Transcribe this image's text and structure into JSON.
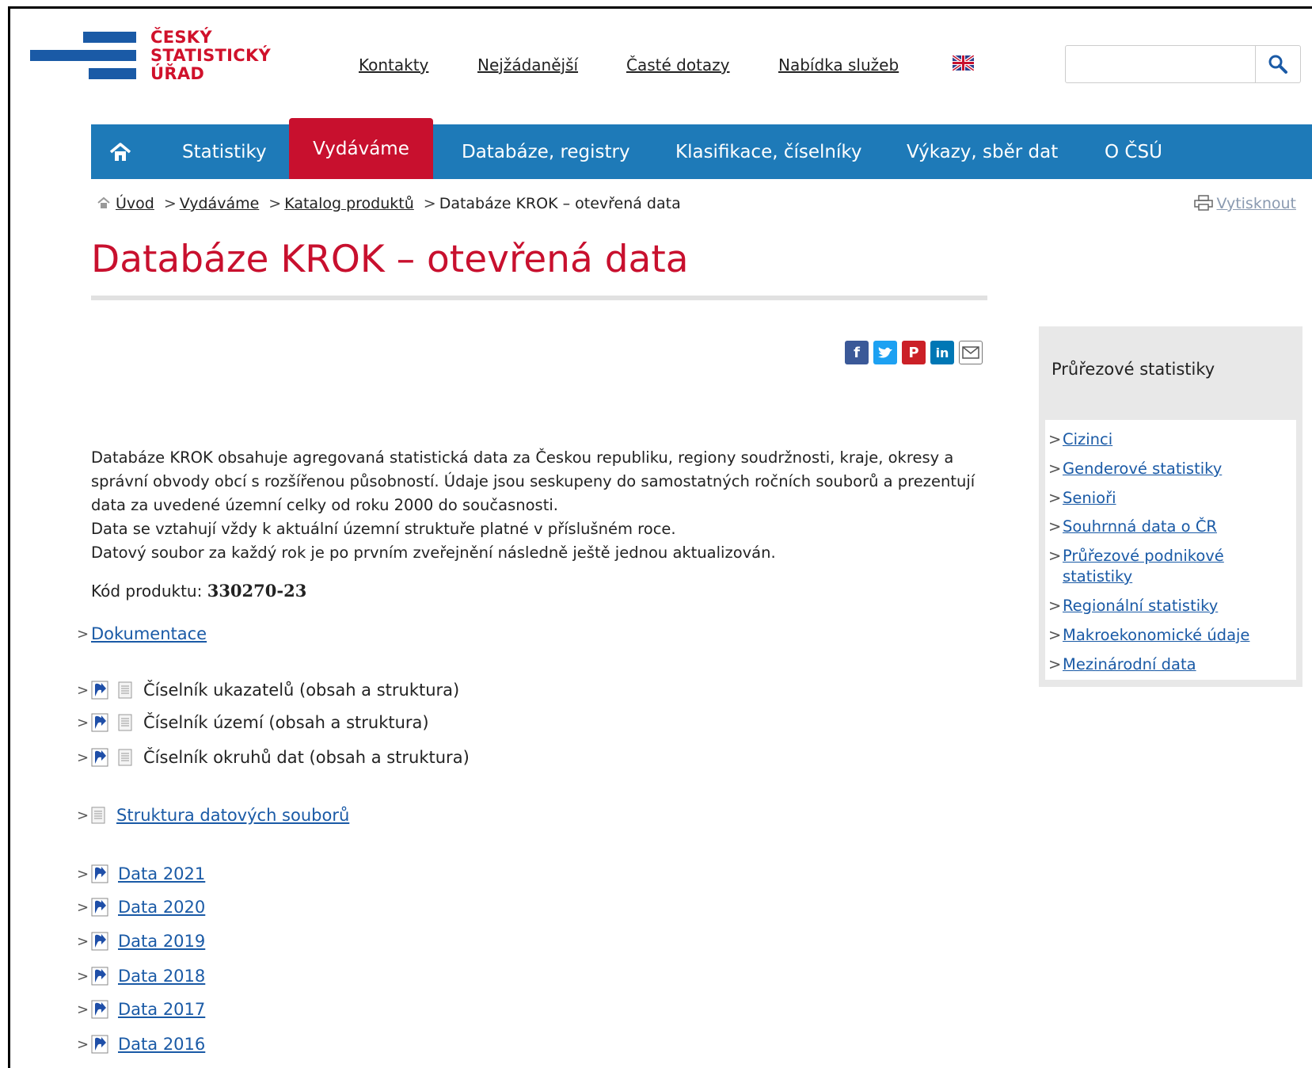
{
  "logo": {
    "line1": "ČESKÝ",
    "line2": "STATISTICKÝ",
    "line3": "ÚŘAD"
  },
  "toplinks": [
    "Kontakty",
    "Nejžádanější",
    "Časté dotazy",
    "Nabídka služeb"
  ],
  "nav": {
    "items": [
      "Statistiky",
      "Vydáváme",
      "Databáze, registry",
      "Klasifikace, číselníky",
      "Výkazy, sběr dat",
      "O ČSÚ"
    ],
    "active": "Vydáváme"
  },
  "breadcrumb": {
    "items": [
      "Úvod",
      "Vydáváme",
      "Katalog produktů"
    ],
    "current": "Databáze KROK – otevřená data",
    "print": "Vytisknout"
  },
  "page_title": "Databáze KROK – otevřená data",
  "description": [
    "Databáze KROK obsahuje agregovaná statistická data za Českou republiku, regiony soudržnosti, kraje, okresy a správní obvody obcí s rozšířenou působností. Údaje jsou seskupeny do samostatných ročních souborů a prezentují data za uvedené územní celky od roku 2000 do současnosti.",
    "Data se vztahují vždy k aktuální územní struktuře platné v příslušném roce.",
    "Datový soubor za každý rok je po prvním zveřejnění následně ještě jednou aktualizován."
  ],
  "product_code": {
    "label": "Kód produktu:",
    "value": "330270-23"
  },
  "documentation": "Dokumentace",
  "codelists": [
    "Číselník ukazatelů (obsah a struktura)",
    "Číselník území (obsah a struktura)",
    "Číselník okruhů dat (obsah a struktura)"
  ],
  "structure_link": "Struktura datových souborů",
  "data_links": [
    "Data 2021",
    "Data 2020",
    "Data 2019",
    "Data 2018",
    "Data 2017",
    "Data 2016"
  ],
  "sidebar": {
    "title": "Průřezové statistiky",
    "items": [
      "Cizinci",
      "Genderové statistiky",
      "Senioři",
      "Souhrnná data o ČR",
      "Průřezové podnikové statistiky",
      "Regionální statistiky",
      "Makroekonomické údaje",
      "Mezinárodní data"
    ]
  },
  "colors": {
    "brand_red": "#c8102e",
    "brand_blue": "#1e7ab8",
    "link": "#1a5aa6"
  }
}
